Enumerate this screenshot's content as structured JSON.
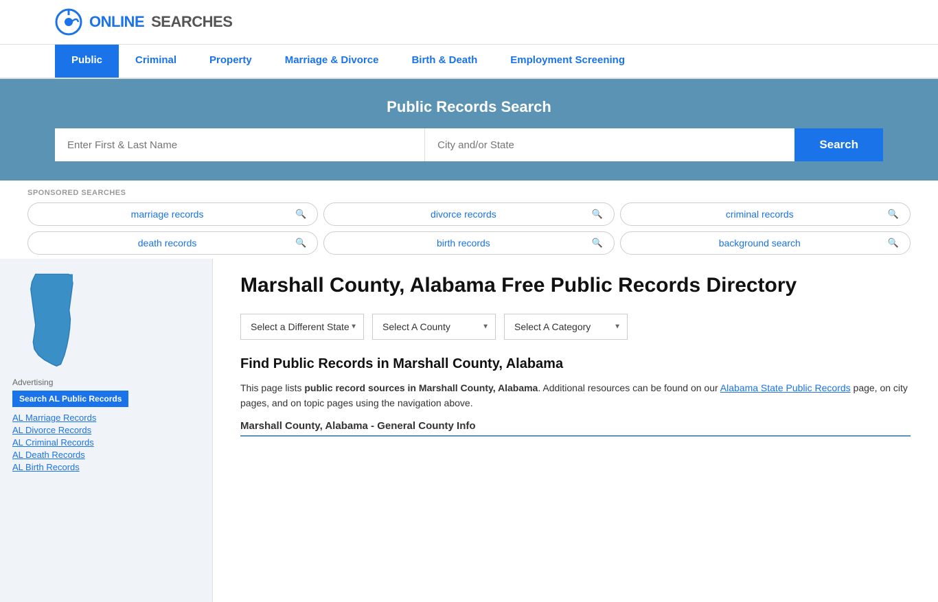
{
  "logo": {
    "text_online": "ONLINE",
    "text_searches": "SEARCHES"
  },
  "nav": {
    "items": [
      {
        "label": "Public",
        "active": true
      },
      {
        "label": "Criminal",
        "active": false
      },
      {
        "label": "Property",
        "active": false
      },
      {
        "label": "Marriage & Divorce",
        "active": false
      },
      {
        "label": "Birth & Death",
        "active": false
      },
      {
        "label": "Employment Screening",
        "active": false
      }
    ]
  },
  "search_banner": {
    "title": "Public Records Search",
    "name_placeholder": "Enter First & Last Name",
    "location_placeholder": "City and/or State",
    "button_label": "Search"
  },
  "sponsored": {
    "label": "SPONSORED SEARCHES",
    "items": [
      {
        "text": "marriage records"
      },
      {
        "text": "divorce records"
      },
      {
        "text": "criminal records"
      },
      {
        "text": "death records"
      },
      {
        "text": "birth records"
      },
      {
        "text": "background search"
      }
    ]
  },
  "sidebar": {
    "advertising_label": "Advertising",
    "ad_banner_label": "Search AL Public Records",
    "links": [
      {
        "label": "AL Marriage Records"
      },
      {
        "label": "AL Divorce Records"
      },
      {
        "label": "AL Criminal Records"
      },
      {
        "label": "AL Death Records"
      },
      {
        "label": "AL Birth Records"
      }
    ]
  },
  "directory": {
    "title": "Marshall County, Alabama Free Public Records Directory",
    "dropdowns": {
      "state_label": "Select a Different State",
      "county_label": "Select A County",
      "category_label": "Select A Category"
    },
    "find_title": "Find Public Records in Marshall County, Alabama",
    "find_desc_part1": "This page lists ",
    "find_desc_bold": "public record sources in Marshall County, Alabama",
    "find_desc_part2": ". Additional resources can be found on our ",
    "find_desc_link": "Alabama State Public Records",
    "find_desc_part3": " page, on city pages, and on topic pages using the navigation above.",
    "county_info_title": "Marshall County, Alabama - General County Info"
  }
}
